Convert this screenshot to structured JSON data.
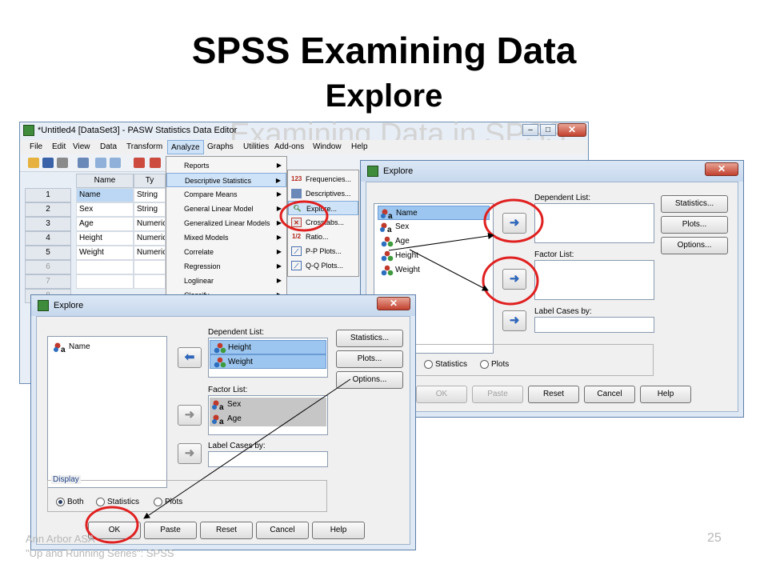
{
  "slide": {
    "title": "SPSS Examining Data",
    "subtitle": "Explore",
    "page_number": "25",
    "footer_line1": "Ann Arbor ASA",
    "footer_line2": "\"Up and Running Series\": SPSS"
  },
  "editor": {
    "title": "*Untitled4 [DataSet3] - PASW Statistics Data Editor",
    "menu": [
      "File",
      "Edit",
      "View",
      "Data",
      "Transform",
      "Analyze",
      "Graphs",
      "Utilities",
      "Add-ons",
      "Window",
      "Help"
    ],
    "columns": [
      "Name",
      "Ty"
    ],
    "rows": [
      {
        "num": "1",
        "name": "Name",
        "type": "String"
      },
      {
        "num": "2",
        "name": "Sex",
        "type": "String"
      },
      {
        "num": "3",
        "name": "Age",
        "type": "Numeric"
      },
      {
        "num": "4",
        "name": "Height",
        "type": "Numeric"
      },
      {
        "num": "5",
        "name": "Weight",
        "type": "Numeric"
      },
      {
        "num": "6",
        "name": "",
        "type": ""
      },
      {
        "num": "7",
        "name": "",
        "type": ""
      },
      {
        "num": "8",
        "name": "",
        "type": ""
      }
    ],
    "background_text": "Examining Data in SPSS"
  },
  "analyze_menu": [
    "Reports",
    "Descriptive Statistics",
    "Compare Means",
    "General Linear Model",
    "Generalized Linear Models",
    "Mixed Models",
    "Correlate",
    "Regression",
    "Loglinear",
    "Classify"
  ],
  "descriptives_submenu": [
    {
      "icon": "123",
      "label": "Frequencies..."
    },
    {
      "icon": "",
      "label": "Descriptives..."
    },
    {
      "icon": "",
      "label": "Explore..."
    },
    {
      "icon": "",
      "label": "Crosstabs..."
    },
    {
      "icon": "1/2",
      "label": "Ratio..."
    },
    {
      "icon": "",
      "label": "P-P Plots..."
    },
    {
      "icon": "",
      "label": "Q-Q Plots..."
    }
  ],
  "explore_back": {
    "title": "Explore",
    "variables": [
      "Name",
      "Sex",
      "Age",
      "Height",
      "Weight"
    ],
    "dependent_label": "Dependent List:",
    "factor_label": "Factor List:",
    "label_cases": "Label Cases by:",
    "side_buttons": [
      "Statistics...",
      "Plots...",
      "Options..."
    ],
    "display_options": [
      "Statistics",
      "Plots"
    ],
    "bottom_buttons": [
      "OK",
      "Paste",
      "Reset",
      "Cancel",
      "Help"
    ]
  },
  "explore_front": {
    "title": "Explore",
    "source_list": [
      "Name"
    ],
    "dependent_label": "Dependent List:",
    "dependent_list": [
      "Height",
      "Weight"
    ],
    "factor_label": "Factor List:",
    "factor_list": [
      "Sex",
      "Age"
    ],
    "label_cases": "Label Cases by:",
    "side_buttons": [
      "Statistics...",
      "Plots...",
      "Options..."
    ],
    "display_group": "Display",
    "display_options": [
      "Both",
      "Statistics",
      "Plots"
    ],
    "display_selected": "Both",
    "bottom_buttons": [
      "OK",
      "Paste",
      "Reset",
      "Cancel",
      "Help"
    ]
  },
  "colors": {
    "highlight_circle": "#e02020",
    "arrow_blue": "#2f66b9",
    "selection": "#9cc6ef"
  }
}
